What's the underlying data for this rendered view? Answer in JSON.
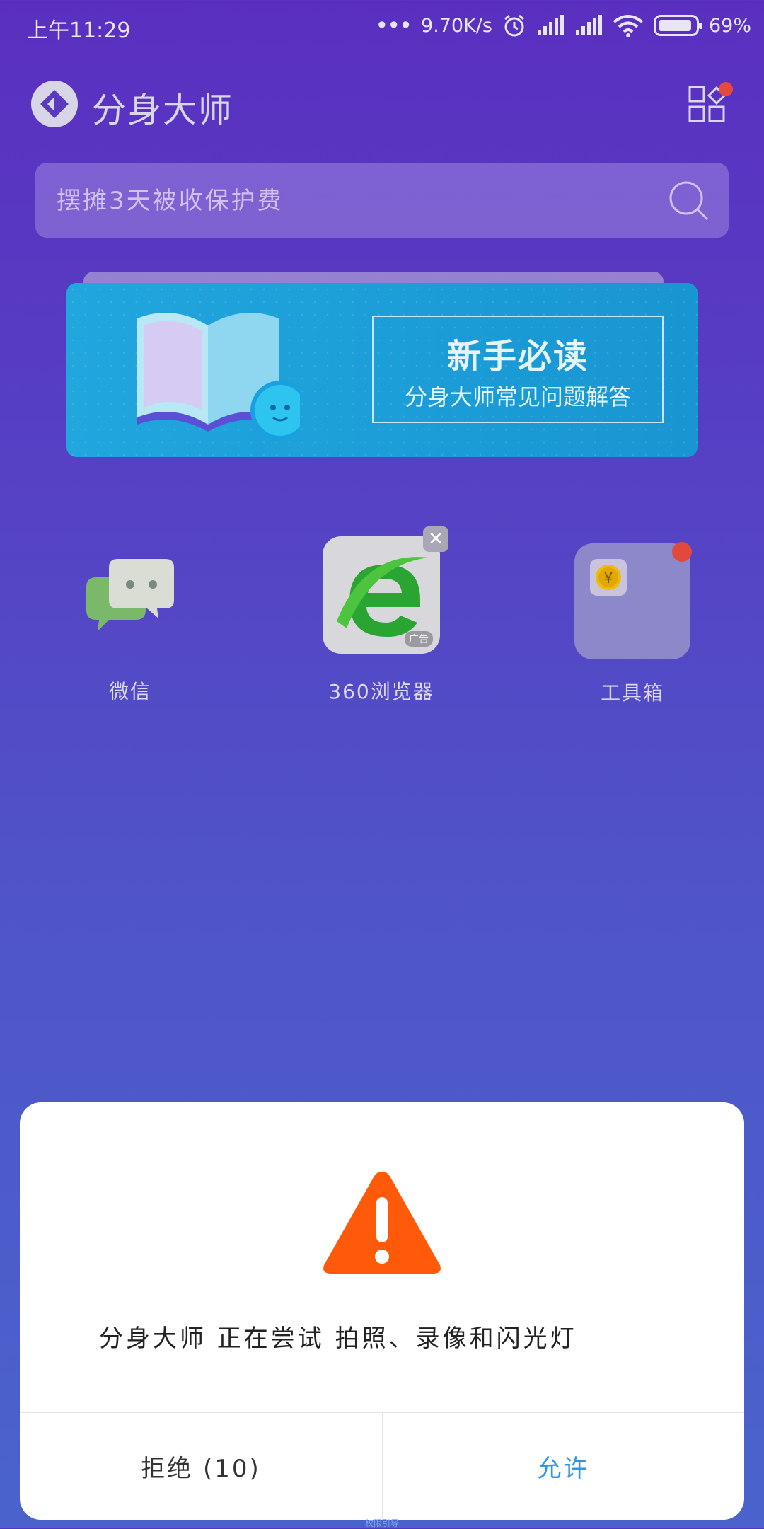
{
  "status_bar": {
    "time": "上午11:29",
    "network_speed": "9.70K/s",
    "battery": "69%",
    "icons": [
      "more-dots-icon",
      "alarm-icon",
      "signal-icon",
      "signal-icon",
      "wifi-icon",
      "battery-icon"
    ]
  },
  "header": {
    "title": "分身大师",
    "logo_icon": "app-logo-icon",
    "menu_icon": "app-grid-icon"
  },
  "search": {
    "placeholder": "摆摊3天被收保护费",
    "icon": "search-icon"
  },
  "banner": {
    "title": "新手必读",
    "subtitle": "分身大师常见问题解答"
  },
  "apps": [
    {
      "label": "微信",
      "icon": "wechat-icon"
    },
    {
      "label": "360浏览器",
      "icon": "browser-360-icon",
      "ad_tag": "广告"
    },
    {
      "label": "工具箱",
      "icon": "toolbox-icon"
    }
  ],
  "dialog": {
    "message": "分身大师 正在尝试 拍照、录像和闪光灯",
    "deny_label": "拒绝 (10)",
    "allow_label": "允许",
    "icon": "warning-icon"
  },
  "bottom_caption": "权限引导",
  "colors": {
    "accent": "#2f95e8",
    "warning": "#ff5a0a",
    "background_top": "#5a2fc0",
    "background_bottom": "#4a63cc"
  }
}
